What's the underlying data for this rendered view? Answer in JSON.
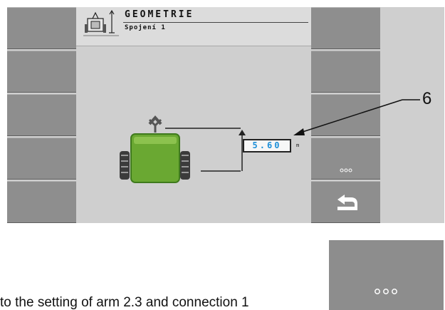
{
  "screen": {
    "header": {
      "title": "GEOMETRIE",
      "subtitle": "Spojení 1",
      "icon": "geometry-machine-icon"
    },
    "value": {
      "reading": "5.60",
      "unit": "m"
    },
    "softkeys": {
      "left": [
        "",
        "",
        "",
        "",
        ""
      ],
      "right": [
        "",
        "",
        "",
        "more-dots-icon",
        "back-return-icon"
      ]
    }
  },
  "callout": {
    "label": "6"
  },
  "caption": {
    "text": "to the setting of arm 2.3 and connection 1"
  },
  "reference_button": {
    "icon": "more-dots-icon"
  },
  "colors": {
    "value_text": "#1e8fd8",
    "machine_green": "#6aa832",
    "softkey_gray": "#8e8e8e",
    "screen_background": "#cfcfcf"
  }
}
